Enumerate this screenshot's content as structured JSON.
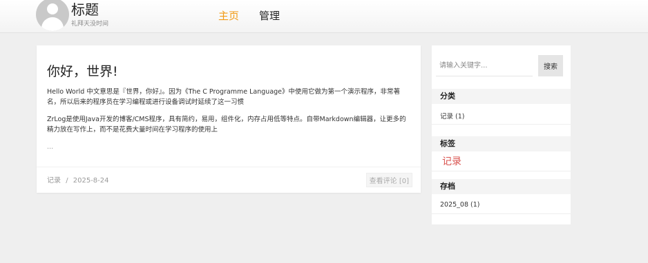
{
  "header": {
    "title": "标题",
    "subtitle": "礼拜天没时间",
    "nav": [
      {
        "label": "主页",
        "active": true
      },
      {
        "label": "管理",
        "active": false
      }
    ]
  },
  "article": {
    "title": "你好，世界!",
    "paragraphs": [
      "Hello World 中文意思是『世界，你好』。因为《The C Programme Language》中使用它做为第一个演示程序，非常著名，所以后来的程序员在学习编程或进行设备调试时延续了这一习惯",
      "ZrLog是使用Java开发的博客/CMS程序，具有简约，易用，组件化，内存占用低等特点。自带Markdown编辑器，让更多的精力放在写作上，而不是花费大量时间在学习程序的使用上"
    ],
    "ellipsis": "...",
    "category": "记录",
    "separator": "/",
    "date": "2025-8-24",
    "comment_link": "查看评论 [0]"
  },
  "sidebar": {
    "search": {
      "placeholder": "请输入关键字...",
      "value": "",
      "button": "搜索"
    },
    "categories": {
      "title": "分类",
      "items": [
        "记录 (1)"
      ]
    },
    "tags": {
      "title": "标签",
      "items": [
        "记录"
      ]
    },
    "archives": {
      "title": "存档",
      "items": [
        "2025_08 (1)"
      ]
    }
  },
  "colors": {
    "accent": "#f29a14",
    "tag": "#d9534f",
    "background": "#efefef"
  }
}
